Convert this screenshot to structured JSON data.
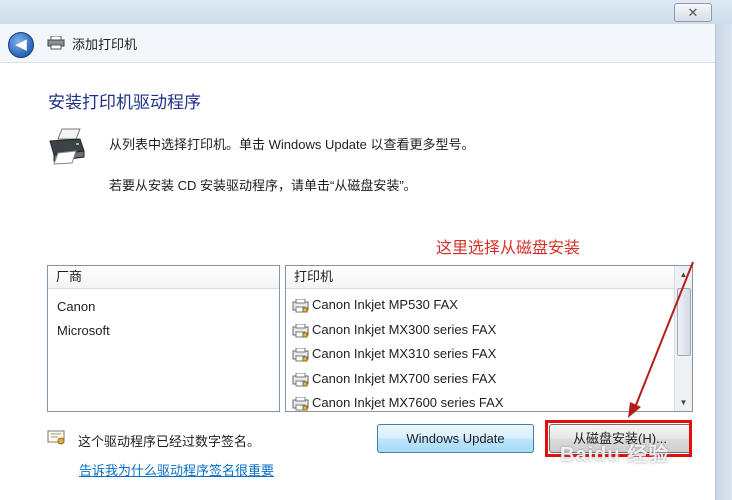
{
  "window": {
    "close_glyph": "✕"
  },
  "nav": {
    "back_glyph": "◀",
    "title": "添加打印机"
  },
  "main": {
    "heading": "安装打印机驱动程序",
    "desc_line1": "从列表中选择打印机。单击 Windows Update 以查看更多型号。",
    "desc_line2": "若要从安装 CD 安装驱动程序，请单击“从磁盘安装”。"
  },
  "annotation": {
    "text": "这里选择从磁盘安装",
    "color": "#d5312a"
  },
  "manufacturer_list": {
    "header": "厂商",
    "items": [
      "Canon",
      "Microsoft"
    ]
  },
  "printer_list": {
    "header": "打印机",
    "items": [
      "Canon Inkjet MP530 FAX",
      "Canon Inkjet MX300 series FAX",
      "Canon Inkjet MX310 series FAX",
      "Canon Inkjet MX700 series FAX",
      "Canon Inkjet MX7600 series FAX"
    ],
    "scroll_up_glyph": "▲",
    "scroll_down_glyph": "▼"
  },
  "footer": {
    "signature_text": "这个驱动程序已经过数字签名。",
    "signature_link": "告诉我为什么驱动程序签名很重要",
    "windows_update_button": "Windows Update",
    "have_disk_button": "从磁盘安装(H)..."
  },
  "watermark": {
    "text": "Baidu 经验"
  },
  "colors": {
    "heading": "#1e3287",
    "link": "#0a6ec7",
    "highlight": "#e01010"
  }
}
